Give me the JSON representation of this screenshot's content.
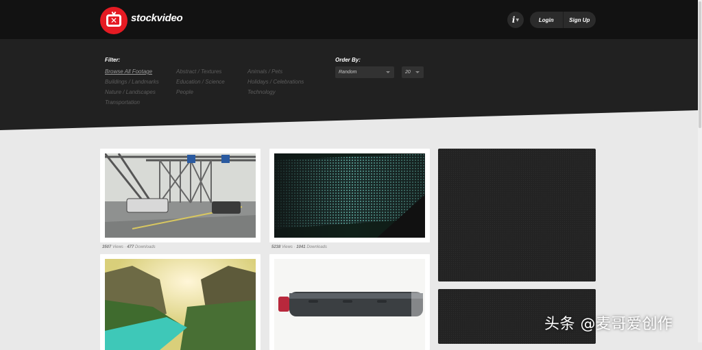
{
  "header": {
    "brand": "stockvideo",
    "info_label": "i",
    "login_label": "Login",
    "signup_label": "Sign Up"
  },
  "filter": {
    "title": "Filter:",
    "columns": [
      [
        "Browse All Footage",
        "Buildings / Landmarks",
        "Nature / Landscapes",
        "Transportation"
      ],
      [
        "Abstract / Textures",
        "Education / Science",
        "People"
      ],
      [
        "Animals / Pets",
        "Holidays / Celebrations",
        "Technology"
      ]
    ]
  },
  "order": {
    "title": "Order By:",
    "sort_value": "Random",
    "count_value": "20"
  },
  "videos": [
    {
      "views": "3507",
      "downloads": "477",
      "views_label": "Views",
      "downloads_label": "Downloads"
    },
    {
      "views": "5238",
      "downloads": "1041",
      "views_label": "Views",
      "downloads_label": "Downloads"
    }
  ],
  "watermark": "头条 @麦哥爱创作",
  "colors": {
    "brand_red": "#e51b23",
    "header_bg": "#121212",
    "filter_bg": "#212121",
    "page_bg": "#e9e9e9"
  },
  "icons": {
    "logo": "tv-x-logo-icon",
    "info": "info-icon",
    "dropdown": "chevron-down-icon"
  }
}
